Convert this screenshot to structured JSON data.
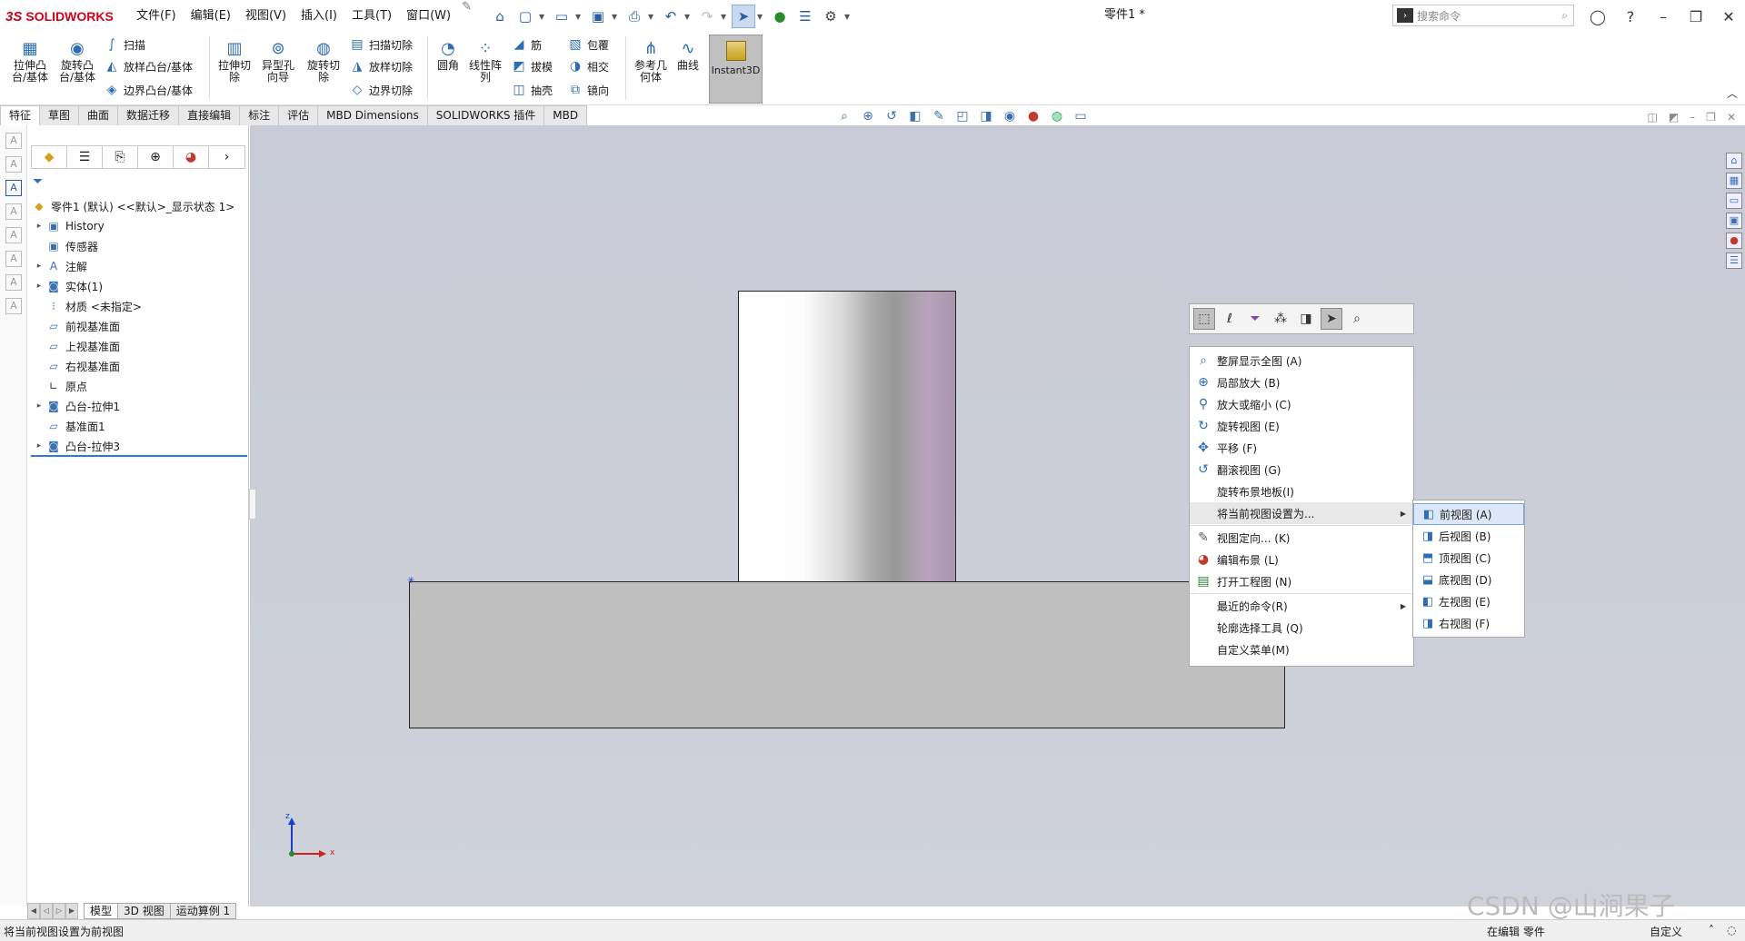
{
  "app": {
    "brand": "SOLIDWORKS",
    "doc_title": "零件1 *"
  },
  "menus": [
    "文件(F)",
    "编辑(E)",
    "视图(V)",
    "插入(I)",
    "工具(T)",
    "窗口(W)"
  ],
  "search": {
    "placeholder": "搜索命令"
  },
  "ribbon": {
    "extrude_boss": "拉伸凸台/基体",
    "revolve_boss": "旋转凸台/基体",
    "sweep": "扫描",
    "loft_boss": "放样凸台/基体",
    "boundary_boss": "边界凸台/基体",
    "extrude_cut": "拉伸切除",
    "hole_wizard": "异型孔向导",
    "revolve_cut": "旋转切除",
    "swept_cut": "扫描切除",
    "lofted_cut": "放样切除",
    "boundary_cut": "边界切除",
    "fillet": "圆角",
    "linear_pattern": "线性阵列",
    "rib": "筋",
    "draft": "拔模",
    "shell": "抽壳",
    "wrap": "包覆",
    "intersect": "相交",
    "mirror": "镜向",
    "ref_geometry": "参考几何体",
    "curves": "曲线",
    "instant3d": "Instant3D"
  },
  "tabs": [
    "特征",
    "草图",
    "曲面",
    "数据迁移",
    "直接编辑",
    "标注",
    "评估",
    "MBD Dimensions",
    "SOLIDWORKS 插件",
    "MBD"
  ],
  "tree": {
    "root": "零件1 (默认) <<默认>_显示状态 1>",
    "items": [
      "History",
      "传感器",
      "注解",
      "实体(1)",
      "材质 <未指定>",
      "前视基准面",
      "上视基准面",
      "右视基准面",
      "原点",
      "凸台-拉伸1",
      "基准面1",
      "凸台-拉伸3"
    ]
  },
  "context_menu": {
    "items": [
      "整屏显示全图 (A)",
      "局部放大 (B)",
      "放大或缩小 (C)",
      "旋转视图 (E)",
      "平移 (F)",
      "翻滚视图 (G)",
      "旋转布景地板(I)",
      "将当前视图设置为...",
      "视图定向... (K)",
      "编辑布景 (L)",
      "打开工程图 (N)",
      "最近的命令(R)",
      "轮廓选择工具 (Q)",
      "自定义菜单(M)"
    ]
  },
  "submenu": {
    "items": [
      "前视图 (A)",
      "后视图 (B)",
      "顶视图 (C)",
      "底视图 (D)",
      "左视图 (E)",
      "右视图 (F)"
    ]
  },
  "bottom_tabs": [
    "模型",
    "3D 视图",
    "运动算例 1"
  ],
  "status": {
    "left": "将当前视图设置为前视图",
    "edit": "在编辑 零件",
    "units": "自定义"
  },
  "triad": {
    "z": "z",
    "x": "x"
  },
  "watermark": "CSDN @山涧果子",
  "colors": {
    "brand": "#d0021b",
    "accent": "#2d6db5",
    "viewport": "#cbced7"
  }
}
